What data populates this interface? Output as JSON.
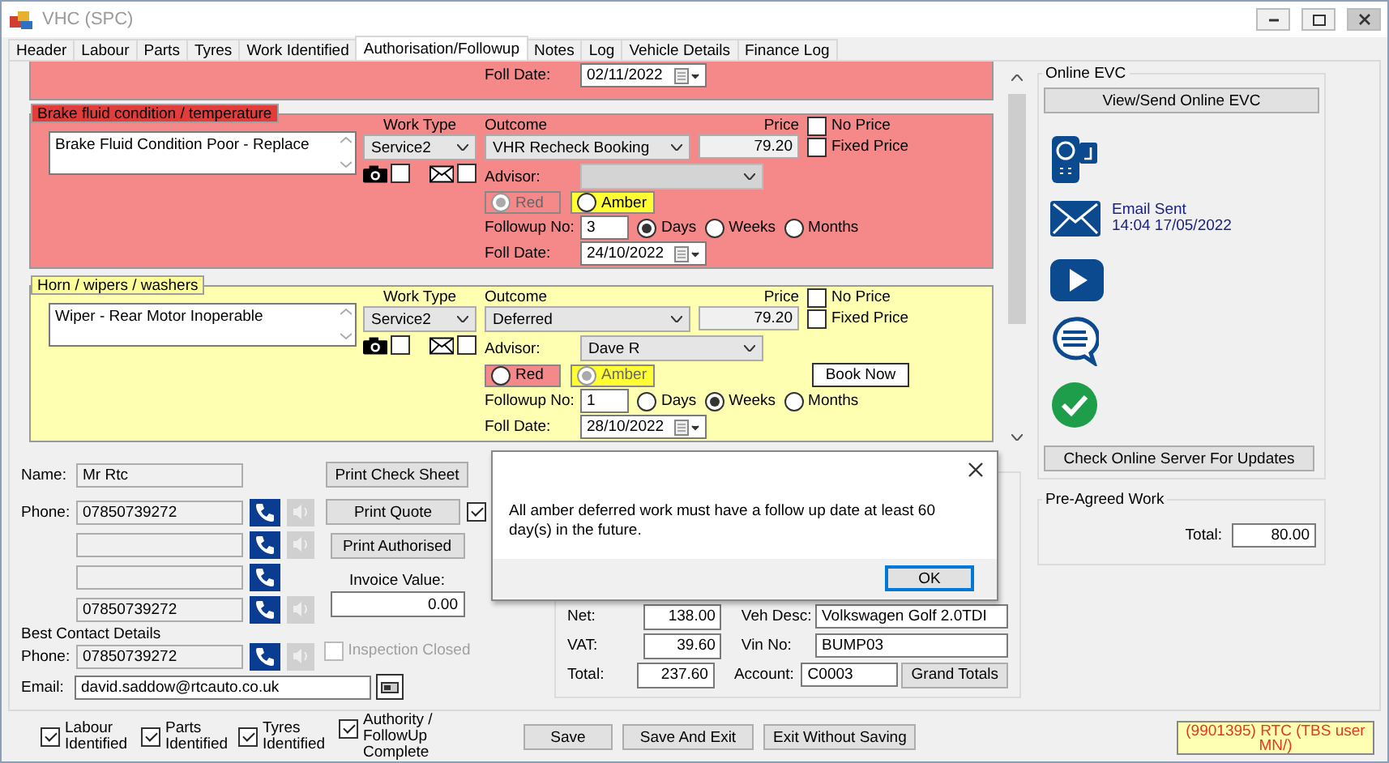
{
  "window": {
    "title": "VHC (SPC)"
  },
  "tabs": [
    {
      "label": "Header",
      "selected": false
    },
    {
      "label": "Labour",
      "selected": false
    },
    {
      "label": "Parts",
      "selected": false
    },
    {
      "label": "Tyres",
      "selected": false
    },
    {
      "label": "Work Identified",
      "selected": false
    },
    {
      "label": "Authorisation/Followup",
      "selected": true
    },
    {
      "label": "Notes",
      "selected": false
    },
    {
      "label": "Log",
      "selected": false
    },
    {
      "label": "Vehicle Details",
      "selected": false
    },
    {
      "label": "Finance Log",
      "selected": false
    }
  ],
  "work_items": [
    {
      "color": "#f58888",
      "labels": {
        "foll_date": "Foll Date:"
      },
      "foll_date": "02/11/2022"
    },
    {
      "color": "#f58888",
      "title": "Brake fluid condition / temperature",
      "description": "Brake Fluid Condition Poor - Replace",
      "labels": {
        "work_type": "Work Type",
        "outcome": "Outcome",
        "price": "Price",
        "advisor": "Advisor:",
        "followup_no": "Followup No:",
        "foll_date": "Foll Date:"
      },
      "work_type": "Service2",
      "photo_checked": false,
      "email_checked": false,
      "outcome": "VHR Recheck Booking",
      "price": "79.20",
      "no_price": {
        "label": "No Price",
        "checked": false
      },
      "fixed_price": {
        "label": "Fixed Price",
        "checked": false
      },
      "advisor_disabled": true,
      "ratings": [
        {
          "label": "Red",
          "selected": true,
          "disabled": true
        },
        {
          "label": "Amber",
          "selected": false,
          "disabled": false
        }
      ],
      "followup_no": "3",
      "units": [
        {
          "label": "Days",
          "selected": true
        },
        {
          "label": "Weeks",
          "selected": false
        },
        {
          "label": "Months",
          "selected": false
        }
      ],
      "foll_date": "24/10/2022"
    },
    {
      "color": "#ffffb2",
      "title": "Horn / wipers / washers",
      "description": "Wiper - Rear Motor Inoperable",
      "labels": {
        "work_type": "Work Type",
        "outcome": "Outcome",
        "price": "Price",
        "advisor": "Advisor:",
        "followup_no": "Followup No:",
        "foll_date": "Foll Date:"
      },
      "work_type": "Service2",
      "photo_checked": false,
      "email_checked": false,
      "outcome": "Deferred",
      "price": "79.20",
      "no_price": {
        "label": "No Price",
        "checked": false
      },
      "fixed_price": {
        "label": "Fixed Price",
        "checked": false
      },
      "advisor": "Dave R",
      "advisor_disabled": false,
      "ratings": [
        {
          "label": "Red",
          "selected": false,
          "disabled": false
        },
        {
          "label": "Amber",
          "selected": true,
          "disabled": true
        }
      ],
      "book_now_button": "Book Now",
      "followup_no": "1",
      "units": [
        {
          "label": "Days",
          "selected": false
        },
        {
          "label": "Weeks",
          "selected": true
        },
        {
          "label": "Months",
          "selected": false
        }
      ],
      "foll_date": "28/10/2022"
    }
  ],
  "online_evc": {
    "title": "Online EVC",
    "view_button": "View/Send Online EVC",
    "email_status": "Email Sent",
    "email_time": "14:04 17/05/2022",
    "check_button": "Check Online Server For Updates"
  },
  "pre_agreed": {
    "title": "Pre-Agreed Work",
    "total_label": "Total:",
    "total": "80.00"
  },
  "contact": {
    "name_label": "Name:",
    "name": "Mr Rtc",
    "phones": [
      {
        "label": "Phone:",
        "value": "07850739272",
        "speaker": true
      },
      {
        "speaker": true
      },
      {
        "speaker": false
      },
      {
        "value": "07850739272",
        "speaker": true
      }
    ],
    "best_contact_label": "Best Contact Details",
    "best_phone_label": "Phone:",
    "best_phone": "07850739272",
    "email_label": "Email:",
    "email": "david.saddow@rtcauto.co.uk"
  },
  "print": {
    "buttons": [
      "Print Check Sheet",
      "Print Quote",
      "Print Authorised"
    ],
    "quote_checked": true,
    "invoice_label": "Invoice Value:",
    "invoice_value": "0.00",
    "inspection_closed": {
      "label": "Inspection Closed",
      "checked": false,
      "disabled": true
    }
  },
  "totals": {
    "rows": [
      {
        "label": "Net:",
        "value": "138.00"
      },
      {
        "label": "VAT:",
        "value": "39.60"
      },
      {
        "label": "Total:",
        "value": "237.60"
      }
    ],
    "vehicle": [
      {
        "label": "Veh Desc:",
        "value": "Volkswagen Golf 2.0TDI"
      },
      {
        "label": "Vin No:",
        "value": "BUMP03"
      },
      {
        "label": "Account:",
        "value": "C0003"
      }
    ],
    "grand_totals_button": "Grand Totals"
  },
  "dialog": {
    "message": "All amber deferred work must have a follow up date at least 60 day(s) in the future.",
    "ok_button": "OK"
  },
  "footer": {
    "checks": [
      {
        "label": "Labour Identified",
        "checked": true
      },
      {
        "label": "Parts Identified",
        "checked": true
      },
      {
        "label": "Tyres Identified",
        "checked": true
      },
      {
        "label": "Authority / FollowUp Complete",
        "checked": true
      }
    ],
    "buttons": [
      "Save",
      "Save And Exit",
      "Exit Without Saving"
    ],
    "status": "(9901395) RTC (TBS user MN/)"
  }
}
